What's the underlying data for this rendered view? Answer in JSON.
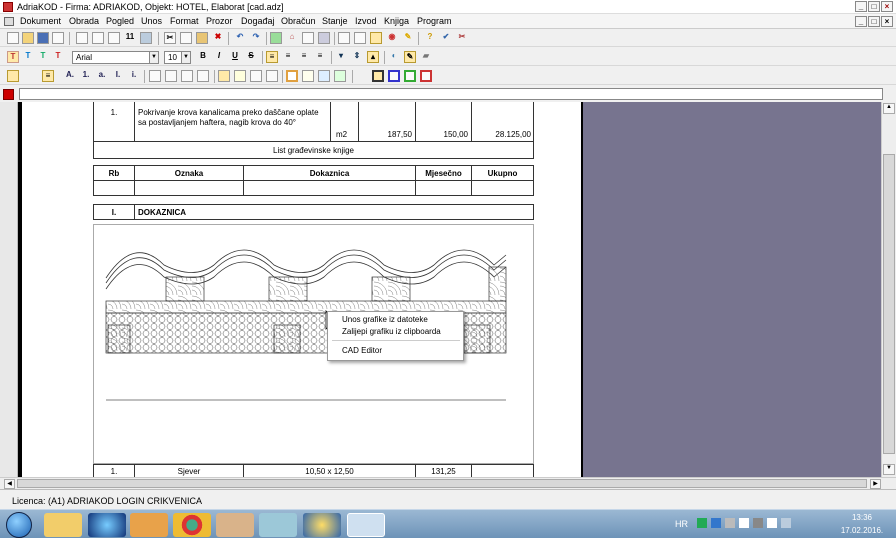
{
  "window": {
    "title": "AdriaKOD - Firma: ADRIAKOD,   Objekt: HOTEL, Elaborat [cad.adz]"
  },
  "menu": [
    "Dokument",
    "Obrada",
    "Pogled",
    "Unos",
    "Format",
    "Prozor",
    "Događaj",
    "Obračun",
    "Stanje",
    "Izvod",
    "Knjiga",
    "Program"
  ],
  "format_toolbar": {
    "font": "Arial",
    "size": "10"
  },
  "document": {
    "row1": {
      "rb": "1.",
      "text": "Pokrivanje krova kanalicama preko daščane oplate sa postavljanjem haftera, nagib krova do 40°",
      "unit": "m2",
      "qty": "187,50",
      "price": "150,00",
      "total": "28.125,00"
    },
    "sheet_title": "List građevinske knjige",
    "headers": [
      "Rb",
      "Oznaka",
      "Dokaznica",
      "Mjesečno",
      "Ukupno"
    ],
    "section": {
      "rb": "I.",
      "title": "DOKAZNICA"
    },
    "row_bottom": {
      "rb": "1.",
      "oznaka": "Sjever",
      "dokaznica": "10,50 x 12,50",
      "mjesecno": "131,25"
    }
  },
  "context_menu": {
    "items": [
      "Unos grafike iz datoteke",
      "Zalijepi grafiku iz clipboarda",
      "CAD Editor"
    ]
  },
  "status": {
    "licence": "Licenca: (A1) ADRIAKOD LOGIN CRIKVENICA"
  },
  "taskbar": {
    "lang": "HR",
    "time": "13:36",
    "date": "17.02.2016."
  },
  "colors": {
    "doc_side": "#77748f",
    "taskbar": "#7fa3c7",
    "accent_red": "#cc0000"
  }
}
